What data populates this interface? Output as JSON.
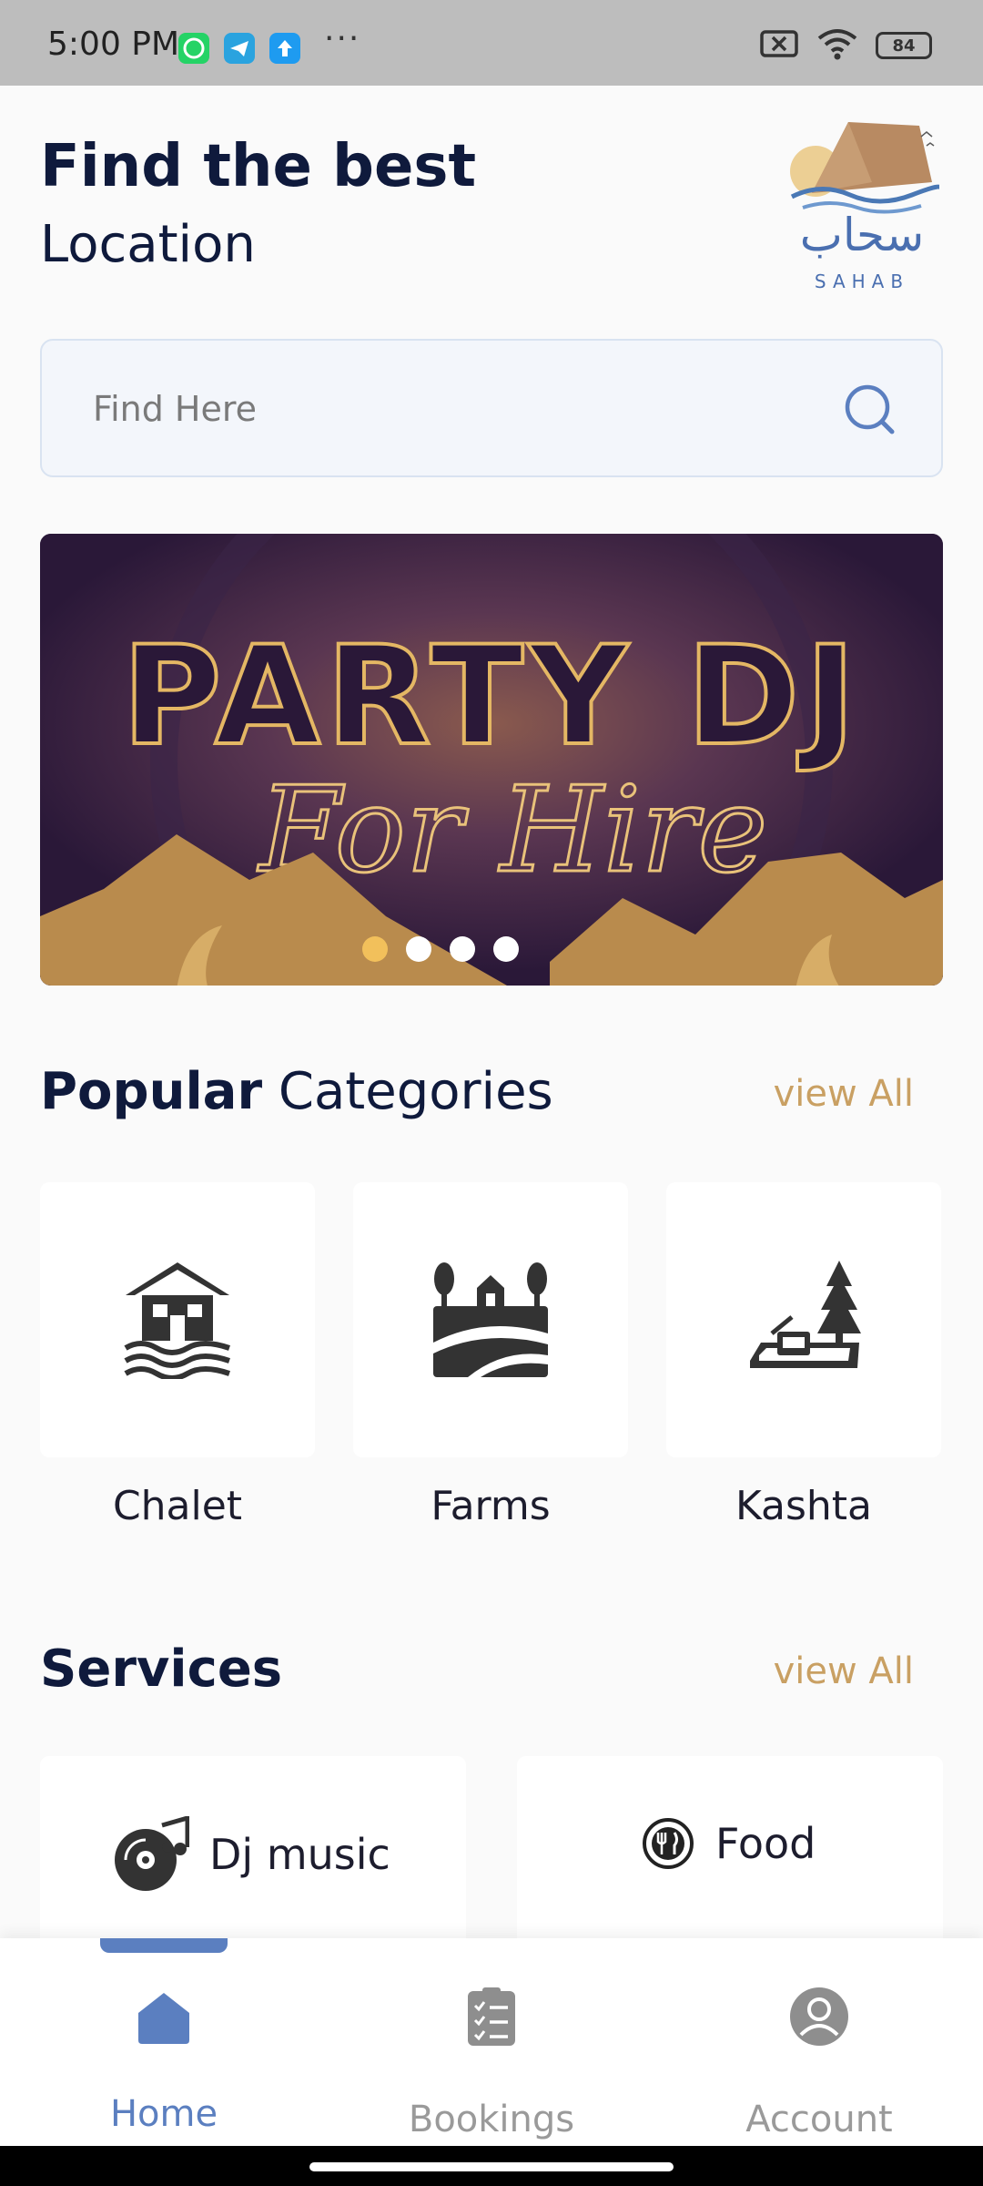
{
  "status_bar": {
    "time": "5:00 PM",
    "battery": "84",
    "apps": [
      "whatsapp-icon",
      "telegram-icon",
      "upload-icon"
    ],
    "more": "···"
  },
  "header": {
    "title": "Find the best",
    "subtitle": "Location",
    "logo": {
      "arabic": "سحاب",
      "latin": "SAHAB"
    }
  },
  "search": {
    "placeholder": "Find Here"
  },
  "banner": {
    "line1": "PARTY DJ",
    "line2": "For Hire",
    "slides": 4,
    "active_slide": 1
  },
  "categories": {
    "title_bold": "Popular",
    "title_rest": " Categories",
    "view_all": "view All",
    "items": [
      {
        "label": "Chalet",
        "icon": "chalet-icon"
      },
      {
        "label": "Farms",
        "icon": "farm-icon"
      },
      {
        "label": "Kashta",
        "icon": "kashta-icon"
      }
    ]
  },
  "services": {
    "title": "Services",
    "view_all": "view All",
    "items": [
      {
        "label": "Dj music",
        "icon": "music-disc-icon"
      },
      {
        "label": "Food",
        "icon": "food-plate-icon"
      }
    ]
  },
  "bottom_nav": {
    "items": [
      {
        "label": "Home",
        "icon": "home-icon",
        "active": true
      },
      {
        "label": "Bookings",
        "icon": "bookings-icon",
        "active": false
      },
      {
        "label": "Account",
        "icon": "account-icon",
        "active": false
      }
    ]
  },
  "colors": {
    "primary": "#5b7fc0",
    "accent_gold": "#c9a063",
    "dark_text": "#0f1a3c",
    "banner_bg": "#2c1a3e"
  }
}
